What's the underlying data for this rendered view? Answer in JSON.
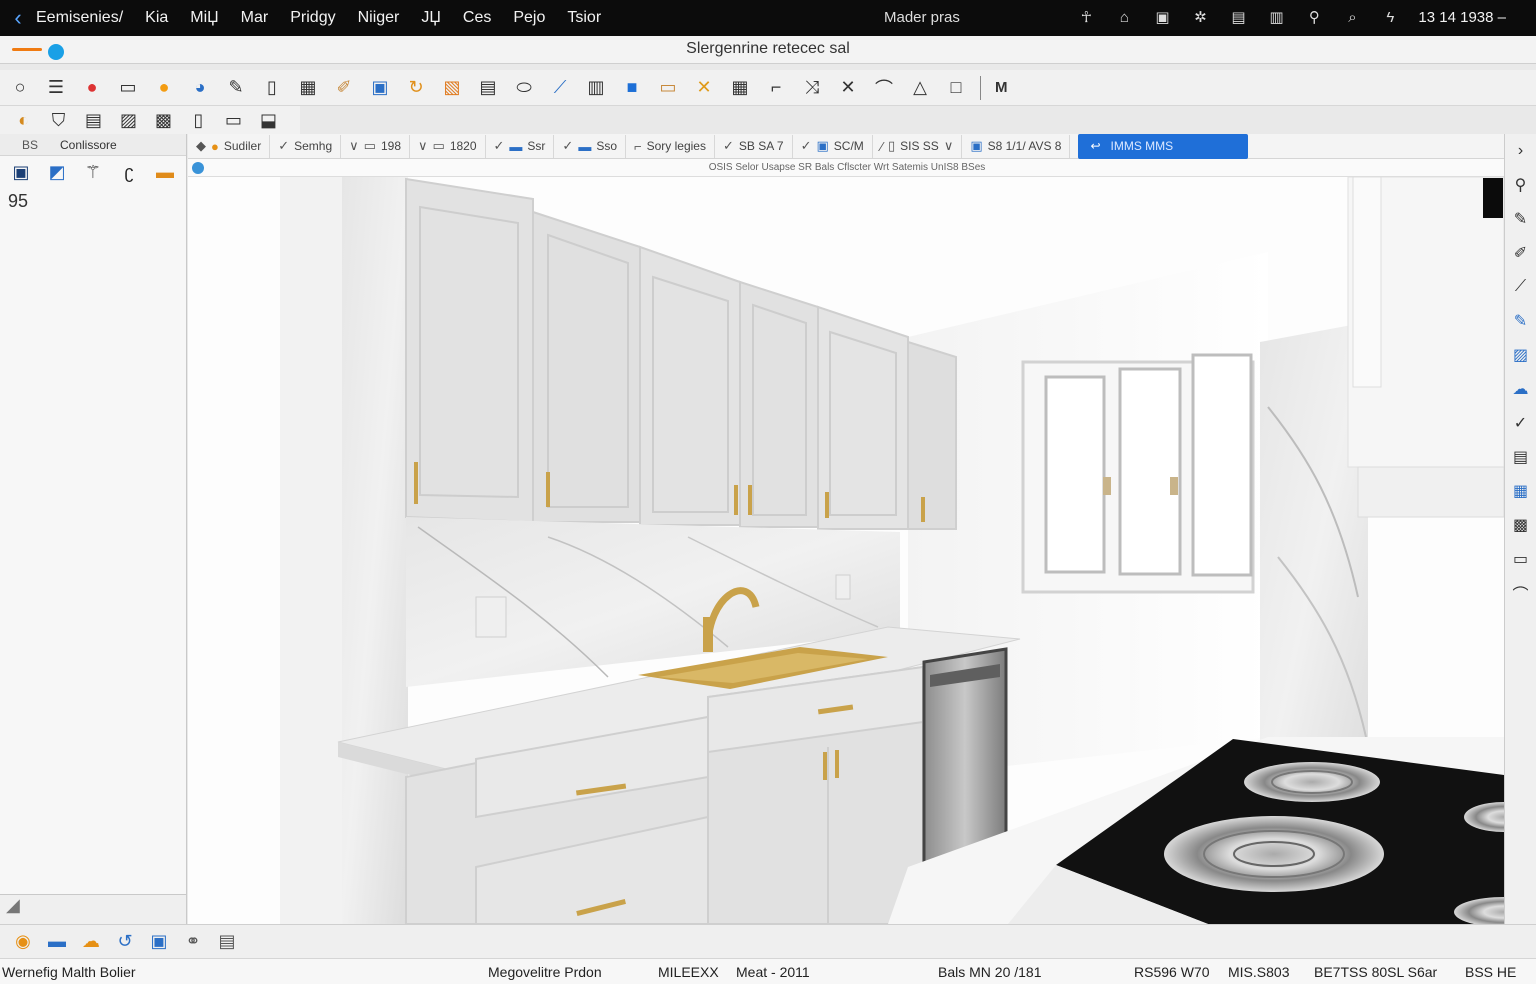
{
  "menubar": {
    "items": [
      "Eemisenies/",
      "Kia",
      "MiЏ",
      "Mar",
      "Pridgy",
      "Niiger",
      "JЏ",
      "Ces",
      "Pejo",
      "Tsior"
    ],
    "center_label": "Mader  pras",
    "clock": "13 14 1938 –"
  },
  "window": {
    "title": "Slergenrine retecec sal"
  },
  "toolbar": {
    "mode_label": "M"
  },
  "left_panel": {
    "header_a": "BS",
    "header_b": "Conlissore",
    "value": "95"
  },
  "options_bar": {
    "items": [
      "Sudiler",
      "Semhg",
      "198",
      "1820",
      "Ssr",
      "Sso",
      "Sory legies",
      "SB SA 7",
      "SC/M",
      "SIS SS",
      "S8 1/1/ AVS 8"
    ],
    "primary_button": "IMMS MMS"
  },
  "info_line": "OSIS Selor Usapse SR Bals Cflscter Wrt Satemis UnIS8 BSes",
  "statusbar": {
    "left": "Wernefig Malth Bolier",
    "center": "Megovelitre Prdon",
    "field1": "MILEEXX",
    "field2": "Meat - 2011",
    "field3": "Bals MN 20 /181",
    "field4": "RS596 W70",
    "field5": "MIS.S803",
    "field6": "BE7TSS 80SL S6ar",
    "field7": "BSS  HE"
  },
  "colors": {
    "accent": "#1f6fd8",
    "menubar": "#0c0c0c",
    "hardware": "#c9a24a"
  }
}
